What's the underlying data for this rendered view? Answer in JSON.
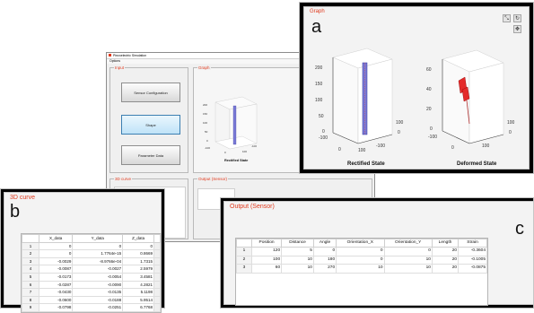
{
  "main_window": {
    "title": "Piezoelectric Simulation",
    "menu": "Options",
    "input_title": "Input",
    "graph_title": "Graph",
    "curve_title": "3D curve",
    "output_title": "Output (Sensor)",
    "buttons": [
      "Sensor Configuration",
      "Shape",
      "Parameter Data"
    ],
    "mini_label": "Rectified State",
    "mini_yticks": [
      "200",
      "150",
      "100",
      "50",
      "0",
      "-100"
    ],
    "mini_xticks": [
      "0",
      "100",
      "-100"
    ]
  },
  "graph_panel": {
    "title": "Graph",
    "letter": "a",
    "left": {
      "label": "Rectified State",
      "yticks": [
        "200",
        "150",
        "100",
        "50",
        "0"
      ],
      "x_axis": [
        "-100",
        "0",
        "100",
        "-100"
      ],
      "depth": [
        "100",
        "0"
      ]
    },
    "right": {
      "label": "Deformed State",
      "yticks": [
        "60",
        "40",
        "20",
        "0"
      ],
      "x_axis": [
        "-100",
        "0",
        "100"
      ],
      "depth": [
        "100",
        "0"
      ]
    }
  },
  "curve_panel": {
    "title": "3D curve",
    "letter": "b",
    "columns": [
      "X_data",
      "Y_data",
      "Z_data"
    ],
    "rows": [
      [
        "1",
        "0",
        "0",
        "0"
      ],
      [
        "2",
        "0",
        "1.7764e-15",
        "0.8669"
      ],
      [
        "3",
        "-0.0029",
        "-8.9766e-04",
        "1.7315"
      ],
      [
        "4",
        "-0.0087",
        "-0.0027",
        "2.5979"
      ],
      [
        "5",
        "-0.0173",
        "-0.0054",
        "3.4581"
      ],
      [
        "6",
        "-0.0287",
        "-0.0090",
        "4.2821"
      ],
      [
        "7",
        "-0.0430",
        "-0.0135",
        "5.1198"
      ],
      [
        "8",
        "-0.0600",
        "-0.0188",
        "5.9514"
      ],
      [
        "9",
        "-0.0798",
        "-0.0251",
        "6.7768"
      ]
    ]
  },
  "output_panel": {
    "title": "Output (Sensor)",
    "letter": "c",
    "columns": [
      "Position",
      "Distance",
      "Angle",
      "Orientation_X",
      "Orientation_Y",
      "Length",
      "Strain"
    ],
    "rows": [
      [
        "1",
        "120",
        "5",
        "0",
        "0",
        "0",
        "20",
        "-0.3604"
      ],
      [
        "2",
        "100",
        "10",
        "180",
        "0",
        "10",
        "20",
        "-0.1005"
      ],
      [
        "3",
        "60",
        "10",
        "270",
        "10",
        "10",
        "20",
        "-0.0875"
      ]
    ]
  },
  "colors": {
    "accent": "#e03a1e",
    "rod": "#7a7ad6",
    "deformed": "#e42a2a"
  }
}
